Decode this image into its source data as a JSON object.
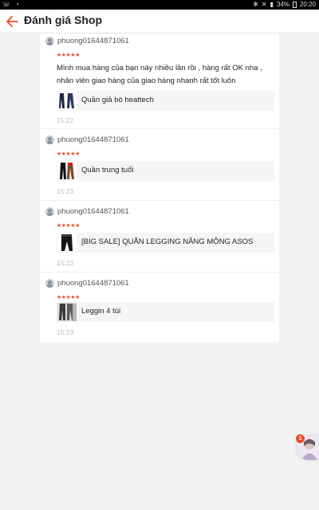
{
  "status_bar": {
    "battery": "34%",
    "time": "20:20"
  },
  "header": {
    "title": "Đánh giá Shop"
  },
  "colors": {
    "accent": "#ee4d2d",
    "star": "#ee4d2d"
  },
  "reviews": [
    {
      "username": "phuong01644871061",
      "stars": "★★★★★",
      "comment": "Mình mua hàng của bạn này nhiều lần rồi , hàng rất OK nha , nhân viên giao hàng của giao hàng nhanh rất tốt luôn",
      "product": "Quần giả bò heattech",
      "time": "15:22"
    },
    {
      "username": "phuong01644871061",
      "stars": "★★★★★",
      "comment": "",
      "product": "Quần trung tuổi",
      "time": "15:23"
    },
    {
      "username": "phuong01644871061",
      "stars": "★★★★★",
      "comment": "",
      "product": "[BIG SALE] QUẦN LEGGING NÂNG MÔNG ASOS",
      "time": "15:23"
    },
    {
      "username": "phuong01644871061",
      "stars": "★★★★★",
      "comment": "",
      "product": "Leggin 4 túi",
      "time": "15:23"
    }
  ],
  "chat_fab": {
    "badge_count": "1"
  }
}
